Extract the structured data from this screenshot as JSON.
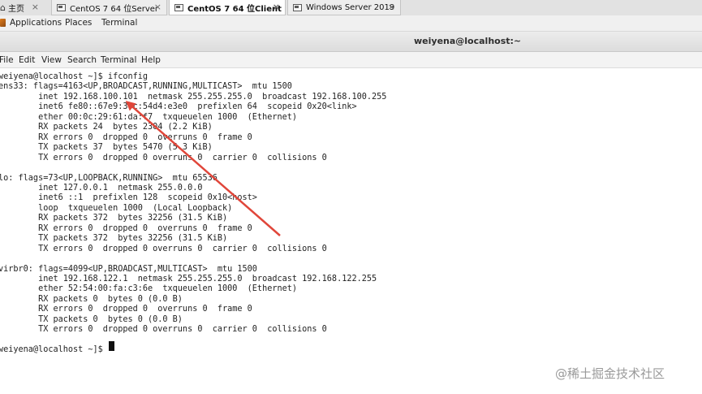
{
  "tabs": [
    {
      "label": "主页",
      "icon": "home-icon"
    },
    {
      "label": "CentOS 7 64 位Server",
      "icon": "vm-icon"
    },
    {
      "label": "CentOS 7 64 位Client",
      "icon": "vm-icon",
      "active": true
    },
    {
      "label": "Windows Server 2019",
      "icon": "vm-icon"
    }
  ],
  "tab_close_glyph": "×",
  "gnome_bar": {
    "applications": "Applications",
    "places": "Places",
    "terminal": "Terminal"
  },
  "window": {
    "title": "weiyena@localhost:~"
  },
  "menu": [
    "File",
    "Edit",
    "View",
    "Search",
    "Terminal",
    "Help"
  ],
  "terminal_lines": [
    "weiyena@localhost ~]$ ifconfig",
    "ens33: flags=4163<UP,BROADCAST,RUNNING,MULTICAST>  mtu 1500",
    "        inet 192.168.100.101  netmask 255.255.255.0  broadcast 192.168.100.255",
    "        inet6 fe80::67e9:30c:54d4:e3e0  prefixlen 64  scopeid 0x20<link>",
    "        ether 00:0c:29:61:da:f7  txqueuelen 1000  (Ethernet)",
    "        RX packets 24  bytes 2304 (2.2 KiB)",
    "        RX errors 0  dropped 0  overruns 0  frame 0",
    "        TX packets 37  bytes 5470 (5.3 KiB)",
    "        TX errors 0  dropped 0 overruns 0  carrier 0  collisions 0",
    "",
    "lo: flags=73<UP,LOOPBACK,RUNNING>  mtu 65536",
    "        inet 127.0.0.1  netmask 255.0.0.0",
    "        inet6 ::1  prefixlen 128  scopeid 0x10<host>",
    "        loop  txqueuelen 1000  (Local Loopback)",
    "        RX packets 372  bytes 32256 (31.5 KiB)",
    "        RX errors 0  dropped 0  overruns 0  frame 0",
    "        TX packets 372  bytes 32256 (31.5 KiB)",
    "        TX errors 0  dropped 0 overruns 0  carrier 0  collisions 0",
    "",
    "virbr0: flags=4099<UP,BROADCAST,MULTICAST>  mtu 1500",
    "        inet 192.168.122.1  netmask 255.255.255.0  broadcast 192.168.122.255",
    "        ether 52:54:00:fa:c3:6e  txqueuelen 1000  (Ethernet)",
    "        RX packets 0  bytes 0 (0.0 B)",
    "        RX errors 0  dropped 0  overruns 0  frame 0",
    "        TX packets 0  bytes 0 (0.0 B)",
    "        TX errors 0  dropped 0 overruns 0  carrier 0  collisions 0",
    "",
    "weiyena@localhost ~]$ "
  ],
  "annotation": {
    "color": "#e0463a"
  },
  "watermark": "@稀土掘金技术社区"
}
